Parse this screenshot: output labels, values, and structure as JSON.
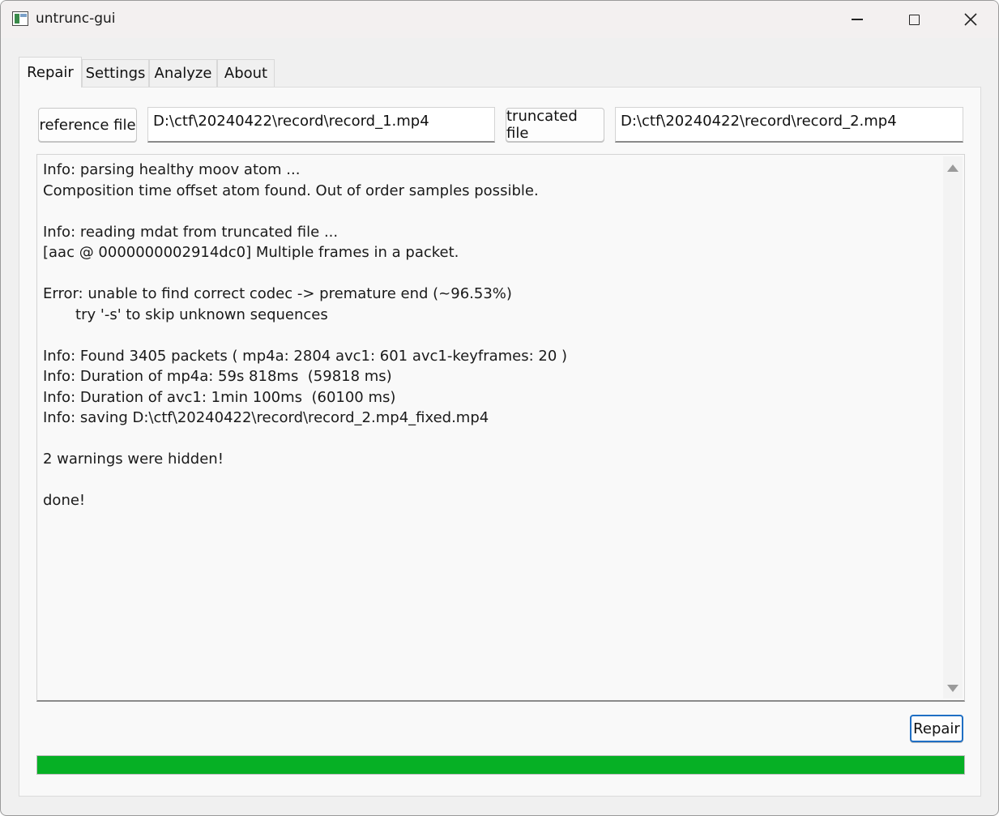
{
  "window": {
    "title": "untrunc-gui",
    "icon": "app-window-icon"
  },
  "tabs": [
    {
      "label": "Repair",
      "active": true
    },
    {
      "label": "Settings",
      "active": false
    },
    {
      "label": "Analyze",
      "active": false
    },
    {
      "label": "About",
      "active": false
    }
  ],
  "repair": {
    "reference_button": "reference file",
    "reference_path": "D:\\ctf\\20240422\\record\\record_1.mp4",
    "truncated_button": "truncated file",
    "truncated_path": "D:\\ctf\\20240422\\record\\record_2.mp4",
    "log_lines": [
      "Info: parsing healthy moov atom ...",
      "Composition time offset atom found. Out of order samples possible.",
      "",
      "Info: reading mdat from truncated file ...",
      "[aac @ 0000000002914dc0] Multiple frames in a packet.",
      "",
      "Error: unable to find correct codec -> premature end (~96.53%)",
      "       try '-s' to skip unknown sequences",
      "",
      "Info: Found 3405 packets ( mp4a: 2804 avc1: 601 avc1-keyframes: 20 )",
      "Info: Duration of mp4a: 59s 818ms  (59818 ms)",
      "Info: Duration of avc1: 1min 100ms  (60100 ms)",
      "Info: saving D:\\ctf\\20240422\\record\\record_2.mp4_fixed.mp4",
      "",
      "2 warnings were hidden!",
      "",
      "done!"
    ],
    "repair_button": "Repair",
    "progress_percent": 100,
    "progress_color": "#06b025"
  },
  "colors": {
    "accent": "#1f6fc4"
  }
}
